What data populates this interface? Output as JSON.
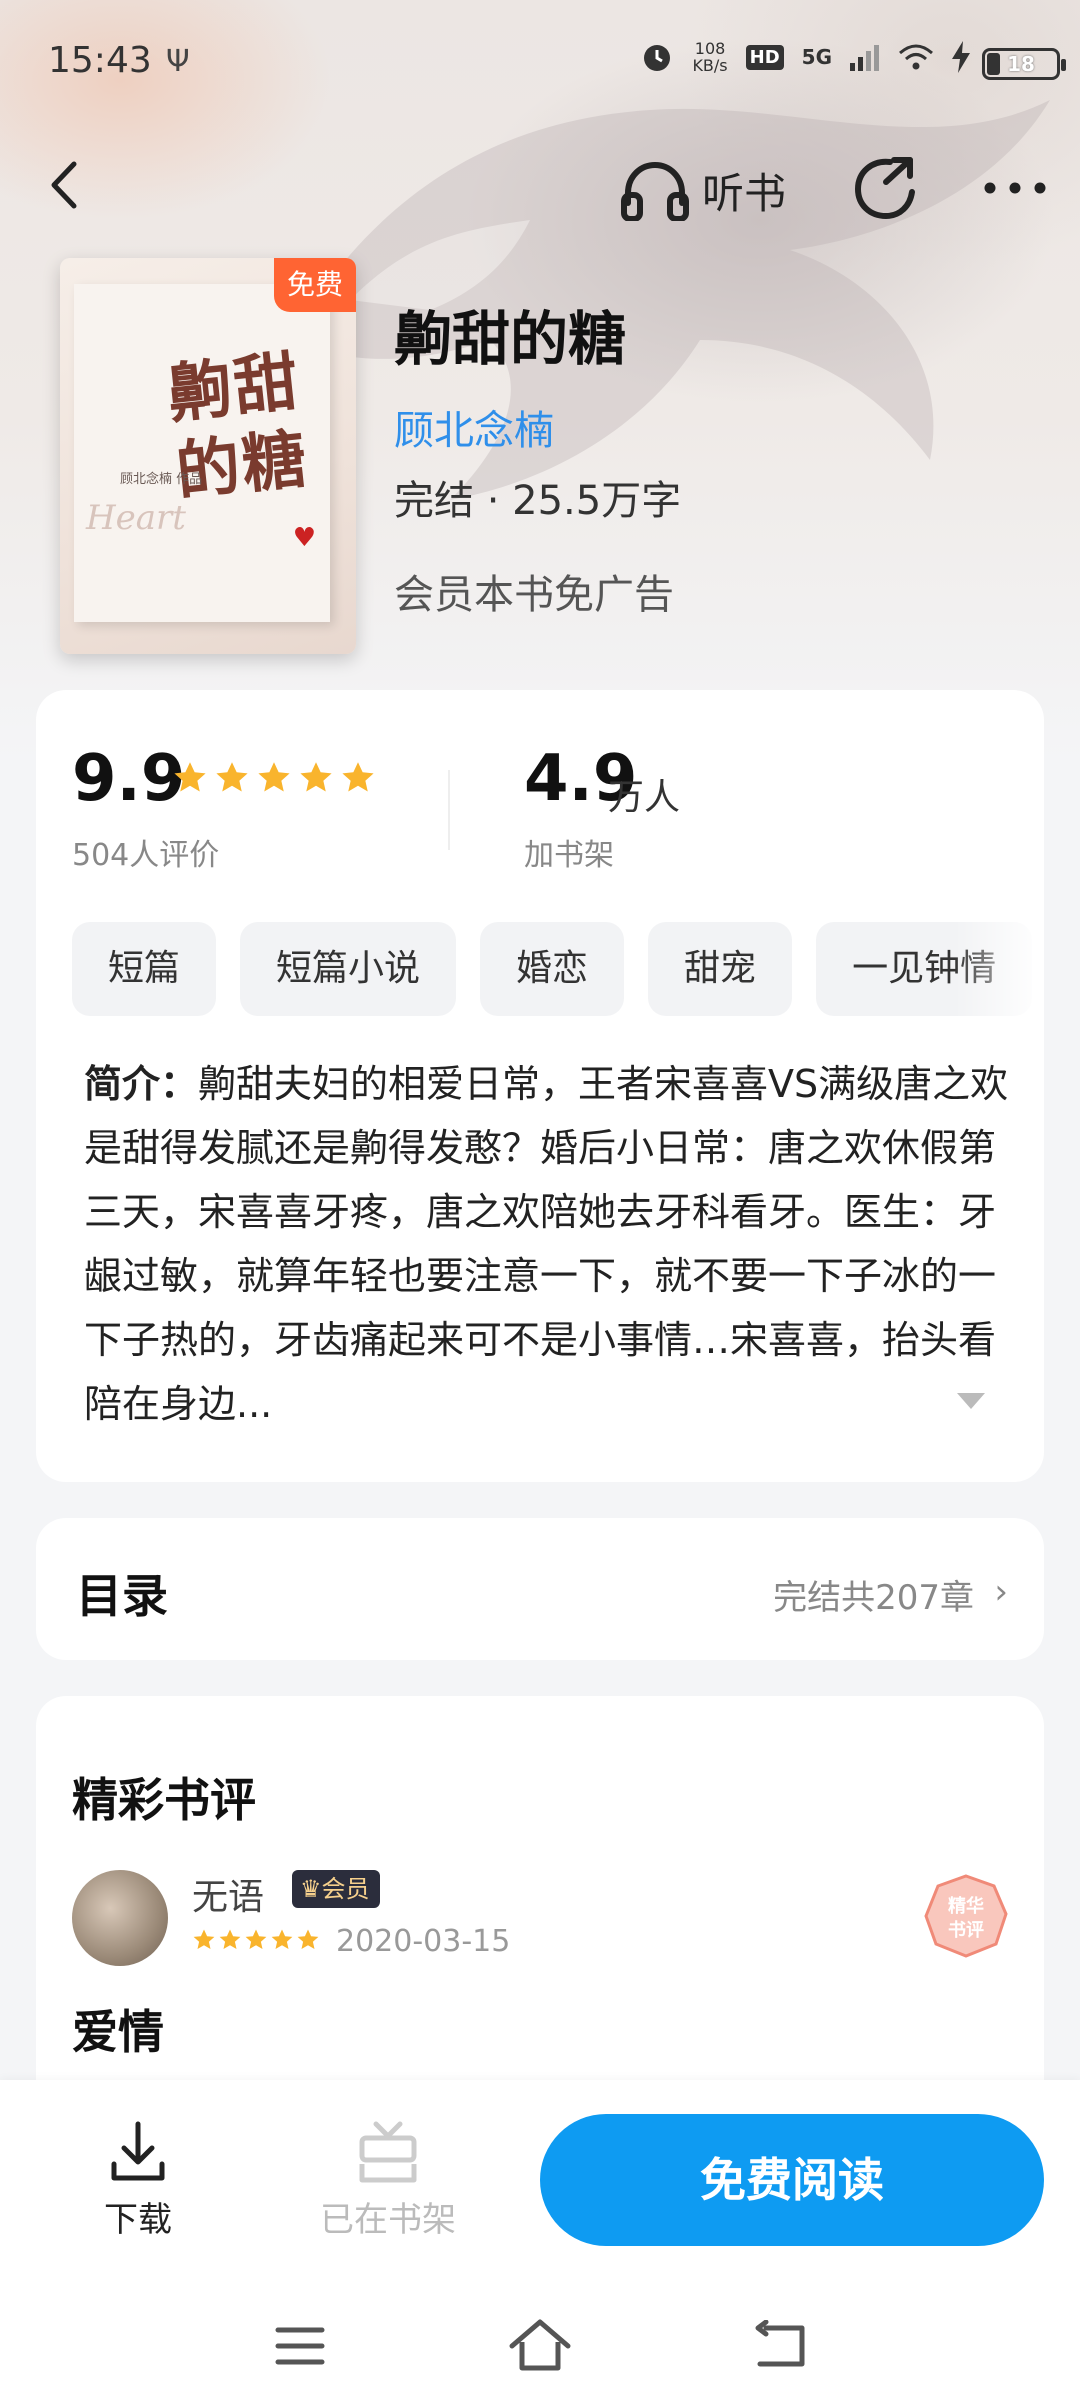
{
  "status_bar": {
    "time": "15:43",
    "speed_value": "108",
    "speed_unit": "KB/s",
    "hd": "HD",
    "network": "5G",
    "battery": "18",
    "battery_level": 0.18
  },
  "nav": {
    "listen_label": "听书"
  },
  "book": {
    "cover_title": "齁甜的糖",
    "cover_author": "顾北念楠 作品",
    "cover_heart": "Heart",
    "free_badge": "免费",
    "title": "齁甜的糖",
    "author": "顾北念楠",
    "meta": "完结 · 25.5万字",
    "adfree": "会员本书免广告"
  },
  "stats": {
    "score": "9.9",
    "stars": 5,
    "rating_count": "504人评价",
    "shelf_num": "4.9",
    "shelf_unit": "万人",
    "shelf_label": "加书架"
  },
  "tags": [
    "短篇",
    "短篇小说",
    "婚恋",
    "甜宠",
    "一见钟情"
  ],
  "intro": {
    "label": "简介：",
    "text": "齁甜夫妇的相爱日常，王者宋喜喜VS满级唐之欢是甜得发腻还是齁得发憨？婚后小日常：唐之欢休假第三天，宋喜喜牙疼，唐之欢陪她去牙科看牙。医生：牙龈过敏，就算年轻也要注意一下，就不要一下子冰的一下子热的，牙齿痛起来可不是小事情…宋喜喜，抬头看陪在身边..."
  },
  "toc": {
    "title": "目录",
    "status": "完结共207章"
  },
  "reviews": {
    "heading": "精彩书评",
    "items": [
      {
        "user": "无语",
        "badge": "会员",
        "stars": 5,
        "date": "2020-03-15",
        "title": "爱情",
        "seal": "精华书评"
      }
    ]
  },
  "actions": {
    "download": "下载",
    "on_shelf": "已在书架",
    "read": "免费阅读"
  },
  "colors": {
    "accent": "#0e9bf2",
    "author_link": "#2f8fea",
    "star": "#f9b42d",
    "free_badge": "#ff6433"
  }
}
